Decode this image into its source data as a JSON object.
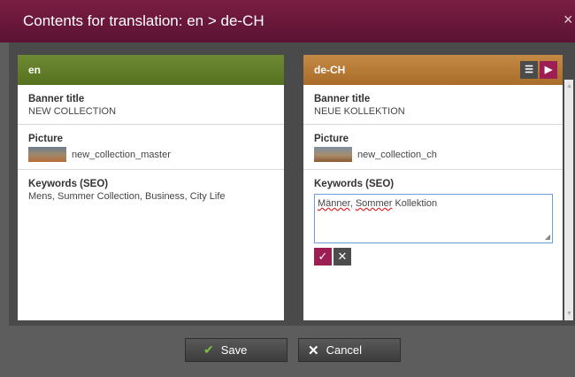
{
  "dialog": {
    "title": "Contents for translation: en > de-CH",
    "close_label": "×"
  },
  "source_panel": {
    "language": "en",
    "fields": {
      "banner_title_label": "Banner title",
      "banner_title_value": "NEW COLLECTION",
      "picture_label": "Picture",
      "picture_value": "new_collection_master",
      "keywords_label": "Keywords (SEO)",
      "keywords_value": "Mens, Summer Collection, Business, City Life"
    }
  },
  "target_panel": {
    "language": "de-CH",
    "header_icons": [
      "list-view-icon",
      "translate-view-icon"
    ],
    "fields": {
      "banner_title_label": "Banner title",
      "banner_title_value": "NEUE KOLLEKTION",
      "picture_label": "Picture",
      "picture_value": "new_collection_ch",
      "keywords_label": "Keywords (SEO)",
      "keywords_word1": "Männer",
      "keywords_sep": ", ",
      "keywords_word2": "Sommer",
      "keywords_word3": " Kollektion"
    }
  },
  "footer": {
    "save_label": "Save",
    "cancel_label": "Cancel"
  },
  "colors": {
    "title_bar": "#6b1a3c",
    "source_header": "#6e8a34",
    "target_header": "#b57833",
    "accent": "#9c1e52"
  }
}
